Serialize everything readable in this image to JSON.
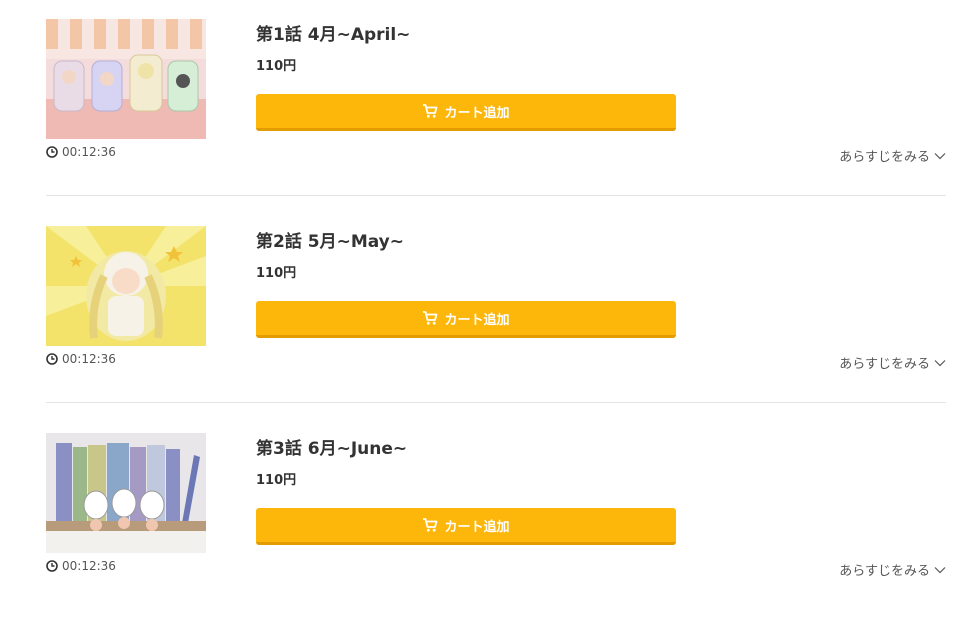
{
  "episodes": [
    {
      "title": "第1話 4月~April~",
      "price": "110円",
      "cart_label": "カート追加",
      "duration": "00:12:36",
      "synopsis_label": "あらすじをみる"
    },
    {
      "title": "第2話 5月~May~",
      "price": "110円",
      "cart_label": "カート追加",
      "duration": "00:12:36",
      "synopsis_label": "あらすじをみる"
    },
    {
      "title": "第3話 6月~June~",
      "price": "110円",
      "cart_label": "カート追加",
      "duration": "00:12:36",
      "synopsis_label": "あらすじをみる"
    }
  ],
  "icons": {
    "duration": "clock-icon",
    "cart": "cart-icon",
    "expand": "chevron-down-icon"
  },
  "colors": {
    "button": "#fdb60a",
    "button_shadow": "#e39c00",
    "divider": "#e4e4e4",
    "text": "#333333"
  }
}
